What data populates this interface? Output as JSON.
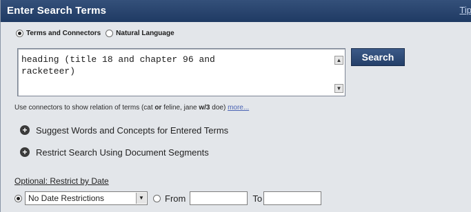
{
  "header": {
    "title": "Enter Search Terms",
    "corner_link": "Tip"
  },
  "search_type": {
    "options": [
      {
        "label": "Terms and Connectors",
        "selected": true
      },
      {
        "label": "Natural Language",
        "selected": false
      }
    ]
  },
  "query": {
    "value": "heading (title 18 and chapter 96 and\nracketeer)"
  },
  "buttons": {
    "search": "Search"
  },
  "hint": {
    "prefix": "Use connectors to show relation of terms (cat ",
    "or": "or",
    "middle": " feline, jane ",
    "w3": "w/3",
    "suffix": " doe) ",
    "more_link": "more..."
  },
  "options": {
    "suggest": "Suggest Words and Concepts for Entered Terms",
    "restrict_segments": "Restrict Search Using Document Segments"
  },
  "date_restrict": {
    "label": "Optional: Restrict by Date",
    "select_value": "No Date Restrictions",
    "from_label": "From",
    "to_label": "To"
  },
  "colors": {
    "title_bar": "#1f3a63",
    "panel_bg": "#e3e6ea",
    "search_button": "#2f4c79"
  }
}
